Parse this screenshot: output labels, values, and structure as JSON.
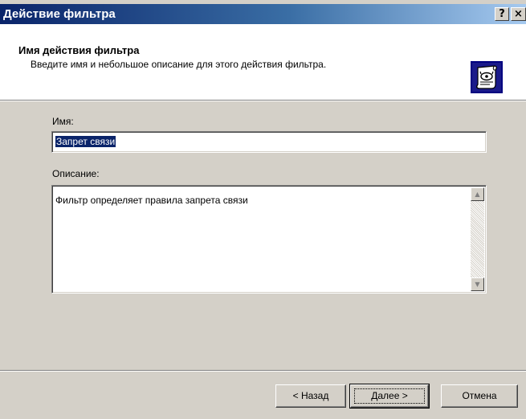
{
  "window": {
    "title": "Действие фильтра",
    "help_button": "?",
    "close_button": "×"
  },
  "header": {
    "title": "Имя действия фильтра",
    "description": "Введите имя и небольшое описание для этого действия фильтра.",
    "icon": "wizard-scroll-icon"
  },
  "form": {
    "name_label": "Имя:",
    "name_value": "Запрет связи",
    "description_label": "Описание:",
    "description_value": "Фильтр определяет правила запрета связи"
  },
  "buttons": {
    "back": "< Назад",
    "next": "Далее >",
    "cancel": "Отмена"
  },
  "colors": {
    "title_bar_start": "#0a246a",
    "title_bar_end": "#a6caf0",
    "dialog_face": "#d4d0c8",
    "selection": "#0a246a"
  }
}
